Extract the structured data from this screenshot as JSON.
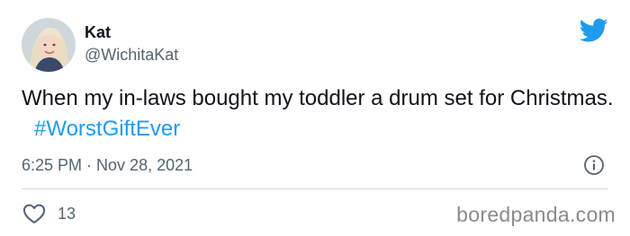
{
  "author": {
    "name": "Kat",
    "handle": "@WichitaKat"
  },
  "tweet": {
    "text": "When my in-laws bought my toddler a drum set for Christmas.",
    "hashtag": "#WorstGiftEver"
  },
  "meta": {
    "time": "6:25 PM",
    "separator": "·",
    "date": "Nov 28, 2021"
  },
  "engagement": {
    "likes": "13"
  },
  "watermark": "boredpanda.com",
  "icons": {
    "brand": "twitter-bird-icon",
    "info": "info-icon",
    "like": "heart-icon"
  },
  "colors": {
    "accent": "#1d9bf0",
    "text": "#0f1419",
    "secondary": "#536471",
    "divider": "#cfd9de"
  }
}
